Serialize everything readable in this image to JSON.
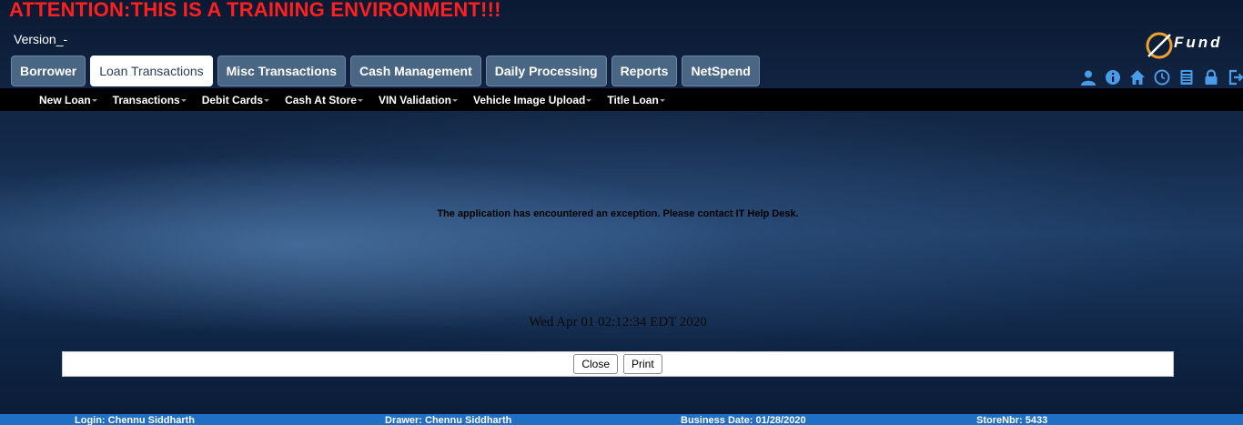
{
  "banner": {
    "attention": "ATTENTION:THIS IS A TRAINING ENVIRONMENT!!!",
    "version": "Version_-"
  },
  "logo": {
    "text": "Fund",
    "letter": "Q"
  },
  "tabs": [
    {
      "label": "Borrower"
    },
    {
      "label": "Loan Transactions",
      "active": true
    },
    {
      "label": "Misc Transactions"
    },
    {
      "label": "Cash Management"
    },
    {
      "label": "Daily Processing"
    },
    {
      "label": "Reports"
    },
    {
      "label": "NetSpend"
    }
  ],
  "toolbar_icons": [
    "user-icon",
    "info-icon",
    "home-icon",
    "clock-icon",
    "calculator-icon",
    "lock-icon",
    "logout-icon"
  ],
  "subnav": [
    {
      "label": "New Loan"
    },
    {
      "label": "Transactions"
    },
    {
      "label": "Debit Cards"
    },
    {
      "label": "Cash At Store"
    },
    {
      "label": "VIN Validation"
    },
    {
      "label": "Vehicle Image Upload"
    },
    {
      "label": "Title Loan"
    }
  ],
  "message": "The application has encountered an exception. Please contact IT Help Desk.",
  "datetime": "Wed Apr 01 02:12:34 EDT 2020",
  "buttons": {
    "close": "Close",
    "print": "Print"
  },
  "footer": {
    "login": "Login: Chennu Siddharth",
    "drawer": "Drawer: Chennu Siddharth",
    "business_date": "Business Date: 01/28/2020",
    "store": "StoreNbr: 5433"
  },
  "colors": {
    "attention": "#ff1f1f",
    "tab": "#4a6685",
    "footer": "#1f6fc4",
    "icon": "#4a9be8"
  }
}
